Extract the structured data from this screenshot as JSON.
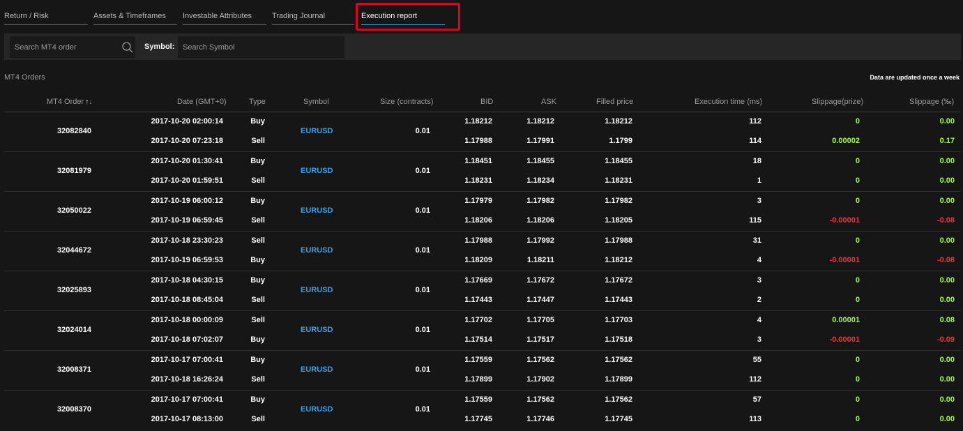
{
  "tabs": [
    {
      "label": "Return / Risk",
      "active": false
    },
    {
      "label": "Assets & Timeframes",
      "active": false
    },
    {
      "label": "Investable Attributes",
      "active": false
    },
    {
      "label": "Trading Journal",
      "active": false
    },
    {
      "label": "Execution report",
      "active": true
    }
  ],
  "filters": {
    "order_placeholder": "Search MT4 order",
    "symbol_label": "Symbol:",
    "symbol_placeholder": "Search Symbol"
  },
  "section_title": "MT4 Orders",
  "update_note": "Data are updated once a week",
  "columns": {
    "order": "MT4 Order",
    "date": "Date (GMT+0)",
    "type": "Type",
    "symbol": "Symbol",
    "size": "Size (contracts)",
    "bid": "BID",
    "ask": "ASK",
    "filled": "Filled price",
    "exec_time": "Execution time (ms)",
    "slip_prize": "Slippage(prize)",
    "slip_permille": "Slippage (‰)"
  },
  "sort_icons": {
    "up": "↑",
    "down": "↓"
  },
  "colors": {
    "positive": "#9eff3c",
    "negative": "#ff2a3a",
    "link": "#3fa0e6",
    "highlight": "#e2001a"
  },
  "orders": [
    {
      "order": "32082840",
      "symbol": "EURUSD",
      "size": "0.01",
      "legs": [
        {
          "date": "2017-10-20 02:00:14",
          "type": "Buy",
          "bid": "1.18212",
          "ask": "1.18212",
          "filled": "1.18212",
          "exec": "112",
          "slip": "0",
          "slip_pm": "0.00"
        },
        {
          "date": "2017-10-20 07:23:18",
          "type": "Sell",
          "bid": "1.17988",
          "ask": "1.17991",
          "filled": "1.1799",
          "exec": "114",
          "slip": "0.00002",
          "slip_pm": "0.17"
        }
      ]
    },
    {
      "order": "32081979",
      "symbol": "EURUSD",
      "size": "0.01",
      "legs": [
        {
          "date": "2017-10-20 01:30:41",
          "type": "Buy",
          "bid": "1.18451",
          "ask": "1.18455",
          "filled": "1.18455",
          "exec": "18",
          "slip": "0",
          "slip_pm": "0.00"
        },
        {
          "date": "2017-10-20 01:59:51",
          "type": "Sell",
          "bid": "1.18231",
          "ask": "1.18234",
          "filled": "1.18231",
          "exec": "1",
          "slip": "0",
          "slip_pm": "0.00"
        }
      ]
    },
    {
      "order": "32050022",
      "symbol": "EURUSD",
      "size": "0.01",
      "legs": [
        {
          "date": "2017-10-19 06:00:12",
          "type": "Buy",
          "bid": "1.17979",
          "ask": "1.17982",
          "filled": "1.17982",
          "exec": "3",
          "slip": "0",
          "slip_pm": "0.00"
        },
        {
          "date": "2017-10-19 06:59:45",
          "type": "Sell",
          "bid": "1.18206",
          "ask": "1.18206",
          "filled": "1.18205",
          "exec": "115",
          "slip": "-0.00001",
          "slip_pm": "-0.08"
        }
      ]
    },
    {
      "order": "32044672",
      "symbol": "EURUSD",
      "size": "0.01",
      "legs": [
        {
          "date": "2017-10-18 23:30:23",
          "type": "Sell",
          "bid": "1.17988",
          "ask": "1.17992",
          "filled": "1.17988",
          "exec": "31",
          "slip": "0",
          "slip_pm": "0.00"
        },
        {
          "date": "2017-10-19 06:59:53",
          "type": "Buy",
          "bid": "1.18209",
          "ask": "1.18211",
          "filled": "1.18212",
          "exec": "4",
          "slip": "-0.00001",
          "slip_pm": "-0.08"
        }
      ]
    },
    {
      "order": "32025893",
      "symbol": "EURUSD",
      "size": "0.01",
      "legs": [
        {
          "date": "2017-10-18 04:30:15",
          "type": "Buy",
          "bid": "1.17669",
          "ask": "1.17672",
          "filled": "1.17672",
          "exec": "3",
          "slip": "0",
          "slip_pm": "0.00"
        },
        {
          "date": "2017-10-18 08:45:04",
          "type": "Sell",
          "bid": "1.17443",
          "ask": "1.17447",
          "filled": "1.17443",
          "exec": "2",
          "slip": "0",
          "slip_pm": "0.00"
        }
      ]
    },
    {
      "order": "32024014",
      "symbol": "EURUSD",
      "size": "0.01",
      "legs": [
        {
          "date": "2017-10-18 00:00:09",
          "type": "Sell",
          "bid": "1.17702",
          "ask": "1.17705",
          "filled": "1.17703",
          "exec": "4",
          "slip": "0.00001",
          "slip_pm": "0.08"
        },
        {
          "date": "2017-10-18 07:02:07",
          "type": "Buy",
          "bid": "1.17514",
          "ask": "1.17517",
          "filled": "1.17518",
          "exec": "3",
          "slip": "-0.00001",
          "slip_pm": "-0.09"
        }
      ]
    },
    {
      "order": "32008371",
      "symbol": "EURUSD",
      "size": "0.01",
      "legs": [
        {
          "date": "2017-10-17 07:00:41",
          "type": "Buy",
          "bid": "1.17559",
          "ask": "1.17562",
          "filled": "1.17562",
          "exec": "55",
          "slip": "0",
          "slip_pm": "0.00"
        },
        {
          "date": "2017-10-18 16:26:24",
          "type": "Sell",
          "bid": "1.17899",
          "ask": "1.17902",
          "filled": "1.17899",
          "exec": "112",
          "slip": "0",
          "slip_pm": "0.00"
        }
      ]
    },
    {
      "order": "32008370",
      "symbol": "EURUSD",
      "size": "0.01",
      "legs": [
        {
          "date": "2017-10-17 07:00:41",
          "type": "Buy",
          "bid": "1.17559",
          "ask": "1.17562",
          "filled": "1.17562",
          "exec": "57",
          "slip": "0",
          "slip_pm": "0.00"
        },
        {
          "date": "2017-10-17 08:13:00",
          "type": "Sell",
          "bid": "1.17745",
          "ask": "1.17746",
          "filled": "1.17745",
          "exec": "113",
          "slip": "0",
          "slip_pm": "0.00"
        }
      ]
    }
  ]
}
